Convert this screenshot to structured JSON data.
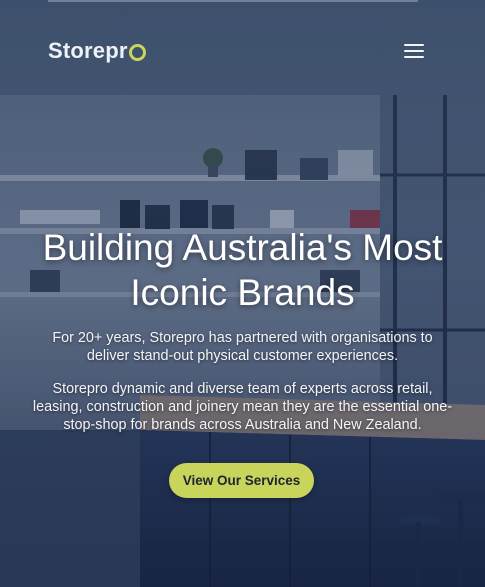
{
  "header": {
    "logo_text": "Storepr"
  },
  "hero": {
    "headline": "Building Australia's Most Iconic Brands",
    "paragraph1": "For 20+ years, Storepro has partnered with organisations to deliver stand-out physical customer experiences.",
    "paragraph2": "Storepro dynamic and diverse team of experts across retail, leasing, construction and joinery mean they are the essential one-stop-shop for brands across Australia and New Zealand.",
    "cta_label": "View Our Services"
  },
  "colors": {
    "accent": "#c8d45a",
    "overlay": "#28406a"
  },
  "icons": {
    "menu": "hamburger-menu-icon"
  }
}
